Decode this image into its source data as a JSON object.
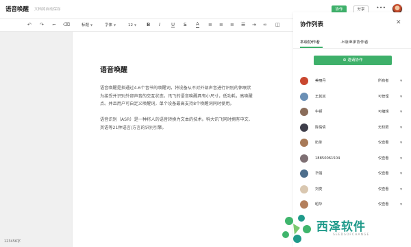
{
  "header": {
    "doc_title": "语音唤醒",
    "save_status": "文档将自动保存",
    "collab_label": "协作",
    "share_label": "分享",
    "more": "•••"
  },
  "toolbar": {
    "undo": "↶",
    "redo": "↷",
    "format_painter": "⌐",
    "clear_format": "⌫",
    "heading_label": "标题",
    "font_label": "字体",
    "size_label": "12",
    "bold": "B",
    "italic": "I",
    "underline": "U",
    "strike": "S",
    "color": "A",
    "align_left": "≡",
    "align_center": "≡",
    "align_right": "≡",
    "list": "☰",
    "indent": "⇥",
    "link": "∞",
    "comment": "◫"
  },
  "document": {
    "heading": "语音唤醒",
    "p1": [
      "语音唤醒是指通过4-6个音节的唤醒词，将设备从不对外部声音进行识别的休眠状",
      "为接受并识别外部声音的交互状态。讯飞的语音唤醒具有小尺寸，低功耗，高唤醒",
      "点。并且用户可自定义唤醒词，单个设备最高支持8个唤醒词同时使用。"
    ],
    "p2": [
      "语音识别（ASR）是一种将人的语音转换为文本的技术。科大讯飞同时拥有中文、",
      "英语等21种语言/方言的识别引擎。"
    ]
  },
  "status": {
    "word_count": "123456字"
  },
  "panel": {
    "title": "协作列表",
    "close": "✕",
    "tab_current": "本级协作者",
    "tab_inherited": "上级继承协作者",
    "invite_label": "邀请协作",
    "members": [
      {
        "name": "美丽丹",
        "role": "所有者",
        "color": "#c9472f"
      },
      {
        "name": "王其其",
        "role": "可管理",
        "color": "#6a8fb5"
      },
      {
        "name": "牛顿",
        "role": "可编辑",
        "color": "#8a6d5a"
      },
      {
        "name": "陈倩倩",
        "role": "无权限",
        "color": "#3e3e4a"
      },
      {
        "name": "奶茶",
        "role": "仅查看",
        "color": "#a87a58"
      },
      {
        "name": "18850061504",
        "role": "仅查看",
        "color": "#7e6f73"
      },
      {
        "name": "华丽",
        "role": "仅查看",
        "color": "#4d6e8c"
      },
      {
        "name": "刘奕",
        "role": "仅查看",
        "color": "#d9c7b0"
      },
      {
        "name": "昭华",
        "role": "仅查看",
        "color": "#b37f5c"
      }
    ]
  },
  "watermark": {
    "name": "西泽软件",
    "sub": "SEEDSOFCHANGE"
  }
}
